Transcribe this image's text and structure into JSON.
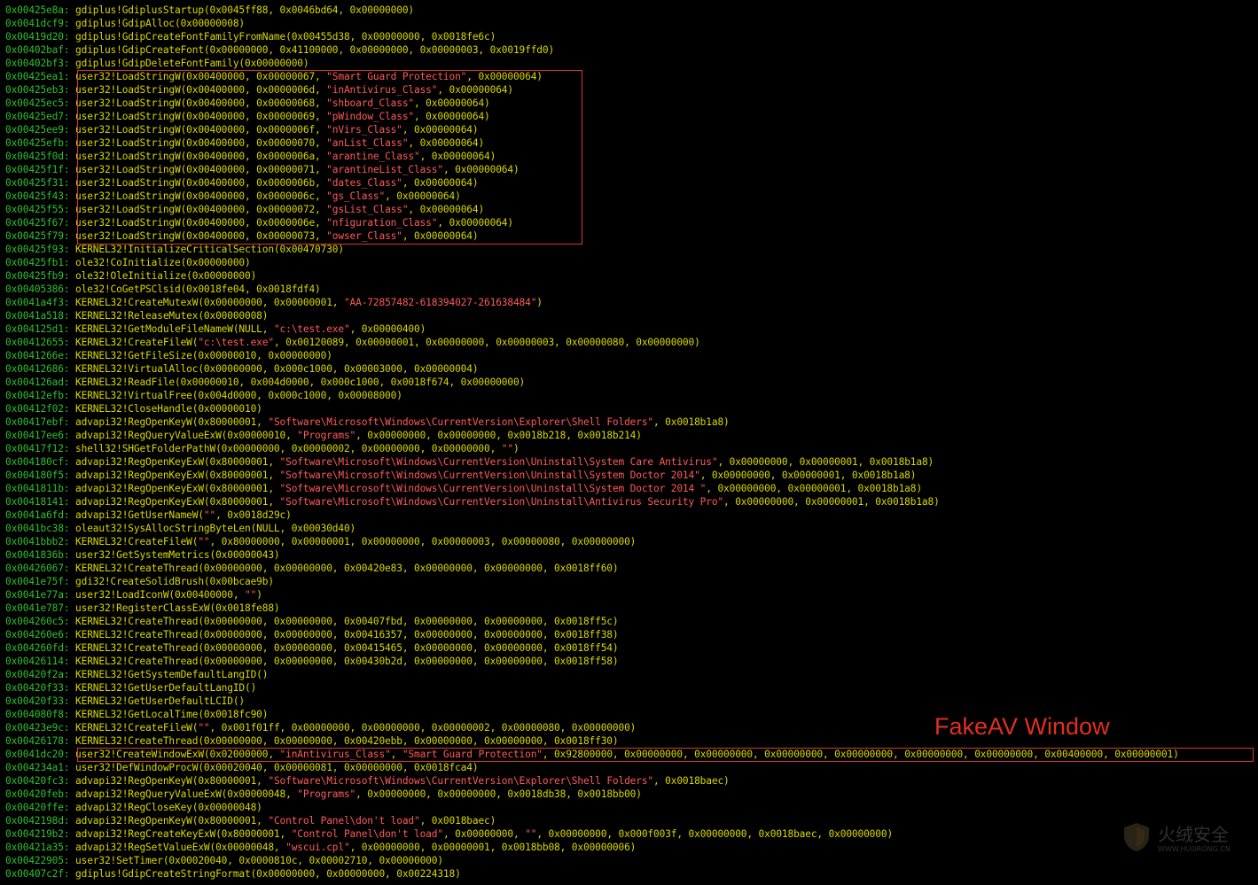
{
  "caption": "FakeAV Window",
  "watermark": {
    "cn": "火绒安全",
    "en": "WWW.HUORONG.CN",
    "icon": "shield-logo-icon"
  },
  "colors": {
    "address": "#2ec02e",
    "function": "#d8d800",
    "string": "#ff5a5a",
    "highlight_box": "#d83a30",
    "caption": "#e0301e"
  },
  "log": [
    {
      "addr": "0x00425e8a:",
      "segs": [
        [
          "f",
          "gdiplus!GdiplusStartup(0x0045ff88, 0x0046bd64, 0x00000000)"
        ]
      ]
    },
    {
      "addr": "0x0041dcf9:",
      "segs": [
        [
          "f",
          "gdiplus!GdipAlloc(0x00000008)"
        ]
      ]
    },
    {
      "addr": "0x00419d20:",
      "segs": [
        [
          "f",
          "gdiplus!GdipCreateFontFamilyFromName(0x00455d38, 0x00000000, 0x0018fe6c)"
        ]
      ]
    },
    {
      "addr": "0x00402baf:",
      "segs": [
        [
          "f",
          "gdiplus!GdipCreateFont(0x00000000, 0x41100000, 0x00000000, 0x00000003, 0x0019ffd0)"
        ]
      ]
    },
    {
      "addr": "0x00402bf3:",
      "segs": [
        [
          "f",
          "gdiplus!GdipDeleteFontFamily(0x00000000)"
        ]
      ]
    },
    {
      "addr": "0x00425ea1:",
      "segs": [
        [
          "f",
          "user32!LoadStringW(0x00400000, 0x00000067, "
        ],
        [
          "s",
          "\"Smart Guard Protection\""
        ],
        [
          "f",
          ", 0x00000064)"
        ]
      ]
    },
    {
      "addr": "0x00425eb3:",
      "segs": [
        [
          "f",
          "user32!LoadStringW(0x00400000, 0x0000006d, "
        ],
        [
          "s",
          "\"inAntivirus_Class\""
        ],
        [
          "f",
          ", 0x00000064)"
        ]
      ]
    },
    {
      "addr": "0x00425ec5:",
      "segs": [
        [
          "f",
          "user32!LoadStringW(0x00400000, 0x00000068, "
        ],
        [
          "s",
          "\"shboard_Class\""
        ],
        [
          "f",
          ", 0x00000064)"
        ]
      ]
    },
    {
      "addr": "0x00425ed7:",
      "segs": [
        [
          "f",
          "user32!LoadStringW(0x00400000, 0x00000069, "
        ],
        [
          "s",
          "\"pWindow_Class\""
        ],
        [
          "f",
          ", 0x00000064)"
        ]
      ]
    },
    {
      "addr": "0x00425ee9:",
      "segs": [
        [
          "f",
          "user32!LoadStringW(0x00400000, 0x0000006f, "
        ],
        [
          "s",
          "\"nVirs_Class\""
        ],
        [
          "f",
          ", 0x00000064)"
        ]
      ]
    },
    {
      "addr": "0x00425efb:",
      "segs": [
        [
          "f",
          "user32!LoadStringW(0x00400000, 0x00000070, "
        ],
        [
          "s",
          "\"anList_Class\""
        ],
        [
          "f",
          ", 0x00000064)"
        ]
      ]
    },
    {
      "addr": "0x00425f0d:",
      "segs": [
        [
          "f",
          "user32!LoadStringW(0x00400000, 0x0000006a, "
        ],
        [
          "s",
          "\"arantine_Class\""
        ],
        [
          "f",
          ", 0x00000064)"
        ]
      ]
    },
    {
      "addr": "0x00425f1f:",
      "segs": [
        [
          "f",
          "user32!LoadStringW(0x00400000, 0x00000071, "
        ],
        [
          "s",
          "\"arantineList_Class\""
        ],
        [
          "f",
          ", 0x00000064)"
        ]
      ]
    },
    {
      "addr": "0x00425f31:",
      "segs": [
        [
          "f",
          "user32!LoadStringW(0x00400000, 0x0000006b, "
        ],
        [
          "s",
          "\"dates_Class\""
        ],
        [
          "f",
          ", 0x00000064)"
        ]
      ]
    },
    {
      "addr": "0x00425f43:",
      "segs": [
        [
          "f",
          "user32!LoadStringW(0x00400000, 0x0000006c, "
        ],
        [
          "s",
          "\"gs_Class\""
        ],
        [
          "f",
          ", 0x00000064)"
        ]
      ]
    },
    {
      "addr": "0x00425f55:",
      "segs": [
        [
          "f",
          "user32!LoadStringW(0x00400000, 0x00000072, "
        ],
        [
          "s",
          "\"gsList_Class\""
        ],
        [
          "f",
          ", 0x00000064)"
        ]
      ]
    },
    {
      "addr": "0x00425f67:",
      "segs": [
        [
          "f",
          "user32!LoadStringW(0x00400000, 0x0000006e, "
        ],
        [
          "s",
          "\"nfiguration_Class\""
        ],
        [
          "f",
          ", 0x00000064)"
        ]
      ]
    },
    {
      "addr": "0x00425f79:",
      "segs": [
        [
          "f",
          "user32!LoadStringW(0x00400000, 0x00000073, "
        ],
        [
          "s",
          "\"owser_Class\""
        ],
        [
          "f",
          ", 0x00000064)"
        ]
      ]
    },
    {
      "addr": "0x00425f93:",
      "segs": [
        [
          "f",
          "KERNEL32!InitializeCriticalSection(0x00470730)"
        ]
      ]
    },
    {
      "addr": "0x00425fb1:",
      "segs": [
        [
          "f",
          "ole32!CoInitialize(0x00000000)"
        ]
      ]
    },
    {
      "addr": "0x00425fb9:",
      "segs": [
        [
          "f",
          "ole32!OleInitialize(0x00000000)"
        ]
      ]
    },
    {
      "addr": "0x00405386:",
      "segs": [
        [
          "f",
          "ole32!CoGetPSClsid(0x0018fe04, 0x0018fdf4)"
        ]
      ]
    },
    {
      "addr": "0x0041a4f3:",
      "segs": [
        [
          "f",
          "KERNEL32!CreateMutexW(0x00000000, 0x00000001, "
        ],
        [
          "s",
          "\"AA-72857482-618394027-261638484\""
        ],
        [
          "f",
          ")"
        ]
      ]
    },
    {
      "addr": "0x0041a518:",
      "segs": [
        [
          "f",
          "KERNEL32!ReleaseMutex(0x00000008)"
        ]
      ]
    },
    {
      "addr": "0x004125d1:",
      "segs": [
        [
          "f",
          "KERNEL32!GetModuleFileNameW(NULL, "
        ],
        [
          "s",
          "\"c:\\test.exe\""
        ],
        [
          "f",
          ", 0x00000400)"
        ]
      ]
    },
    {
      "addr": "0x00412655:",
      "segs": [
        [
          "f",
          "KERNEL32!CreateFileW("
        ],
        [
          "s",
          "\"c:\\test.exe\""
        ],
        [
          "f",
          ", 0x00120089, 0x00000001, 0x00000000, 0x00000003, 0x00000080, 0x00000000)"
        ]
      ]
    },
    {
      "addr": "0x0041266e:",
      "segs": [
        [
          "f",
          "KERNEL32!GetFileSize(0x00000010, 0x00000000)"
        ]
      ]
    },
    {
      "addr": "0x00412686:",
      "segs": [
        [
          "f",
          "KERNEL32!VirtualAlloc(0x00000000, 0x000c1000, 0x00003000, 0x00000004)"
        ]
      ]
    },
    {
      "addr": "0x004126ad:",
      "segs": [
        [
          "f",
          "KERNEL32!ReadFile(0x00000010, 0x004d0000, 0x000c1000, 0x0018f674, 0x00000000)"
        ]
      ]
    },
    {
      "addr": "0x00412efb:",
      "segs": [
        [
          "f",
          "KERNEL32!VirtualFree(0x004d0000, 0x000c1000, 0x00008000)"
        ]
      ]
    },
    {
      "addr": "0x00412f02:",
      "segs": [
        [
          "f",
          "KERNEL32!CloseHandle(0x00000010)"
        ]
      ]
    },
    {
      "addr": "0x00417ebf:",
      "segs": [
        [
          "f",
          "advapi32!RegOpenKeyW(0x80000001, "
        ],
        [
          "s",
          "\"Software\\Microsoft\\Windows\\CurrentVersion\\Explorer\\Shell Folders\""
        ],
        [
          "f",
          ", 0x0018b1a8)"
        ]
      ]
    },
    {
      "addr": "0x00417ee6:",
      "segs": [
        [
          "f",
          "advapi32!RegQueryValueExW(0x00000010, "
        ],
        [
          "s",
          "\"Programs\""
        ],
        [
          "f",
          ", 0x00000000, 0x00000000, 0x0018b218, 0x0018b214)"
        ]
      ]
    },
    {
      "addr": "0x00417f12:",
      "segs": [
        [
          "f",
          "shell32!SHGetFolderPathW(0x00000000, 0x00000002, 0x00000000, 0x00000000, "
        ],
        [
          "s",
          "\"\""
        ],
        [
          "f",
          ")"
        ]
      ]
    },
    {
      "addr": "0x004180cf:",
      "segs": [
        [
          "f",
          "advapi32!RegOpenKeyExW(0x80000001, "
        ],
        [
          "s",
          "\"Software\\Microsoft\\Windows\\CurrentVersion\\Uninstall\\System Care Antivirus\""
        ],
        [
          "f",
          ", 0x00000000, 0x00000001, 0x0018b1a8)"
        ]
      ]
    },
    {
      "addr": "0x004180f5:",
      "segs": [
        [
          "f",
          "advapi32!RegOpenKeyExW(0x80000001, "
        ],
        [
          "s",
          "\"Software\\Microsoft\\Windows\\CurrentVersion\\Uninstall\\System Doctor 2014\""
        ],
        [
          "f",
          ", 0x00000000, 0x00000001, 0x0018b1a8)"
        ]
      ]
    },
    {
      "addr": "0x0041811b:",
      "segs": [
        [
          "f",
          "advapi32!RegOpenKeyExW(0x80000001, "
        ],
        [
          "s",
          "\"Software\\Microsoft\\Windows\\CurrentVersion\\Uninstall\\System Doctor 2014 \""
        ],
        [
          "f",
          ", 0x00000000, 0x00000001, 0x0018b1a8)"
        ]
      ]
    },
    {
      "addr": "0x00418141:",
      "segs": [
        [
          "f",
          "advapi32!RegOpenKeyExW(0x80000001, "
        ],
        [
          "s",
          "\"Software\\Microsoft\\Windows\\CurrentVersion\\Uninstall\\Antivirus Security Pro\""
        ],
        [
          "f",
          ", 0x00000000, 0x00000001, 0x0018b1a8)"
        ]
      ]
    },
    {
      "addr": "0x0041a6fd:",
      "segs": [
        [
          "f",
          "advapi32!GetUserNameW("
        ],
        [
          "s",
          "\"\""
        ],
        [
          "f",
          ", 0x0018d29c)"
        ]
      ]
    },
    {
      "addr": "0x0041bc38:",
      "segs": [
        [
          "f",
          "oleaut32!SysAllocStringByteLen(NULL, 0x00030d40)"
        ]
      ]
    },
    {
      "addr": "0x0041bbb2:",
      "segs": [
        [
          "f",
          "KERNEL32!CreateFileW("
        ],
        [
          "s",
          "\"\""
        ],
        [
          "f",
          ", 0x80000000, 0x00000001, 0x00000000, 0x00000003, 0x00000080, 0x00000000)"
        ]
      ]
    },
    {
      "addr": "0x0041836b:",
      "segs": [
        [
          "f",
          "user32!GetSystemMetrics(0x00000043)"
        ]
      ]
    },
    {
      "addr": "0x00426067:",
      "segs": [
        [
          "f",
          "KERNEL32!CreateThread(0x00000000, 0x00000000, 0x00420e83, 0x00000000, 0x00000000, 0x0018ff60)"
        ]
      ]
    },
    {
      "addr": "0x0041e75f:",
      "segs": [
        [
          "f",
          "gdi32!CreateSolidBrush(0x00bcae9b)"
        ]
      ]
    },
    {
      "addr": "0x0041e77a:",
      "segs": [
        [
          "f",
          "user32!LoadIconW(0x00400000, "
        ],
        [
          "s",
          "\"\""
        ],
        [
          "f",
          ")"
        ]
      ]
    },
    {
      "addr": "0x0041e787:",
      "segs": [
        [
          "f",
          "user32!RegisterClassExW(0x0018fe88)"
        ]
      ]
    },
    {
      "addr": "0x004260c5:",
      "segs": [
        [
          "f",
          "KERNEL32!CreateThread(0x00000000, 0x00000000, 0x00407fbd, 0x00000000, 0x00000000, 0x0018ff5c)"
        ]
      ]
    },
    {
      "addr": "0x004260e6:",
      "segs": [
        [
          "f",
          "KERNEL32!CreateThread(0x00000000, 0x00000000, 0x00416357, 0x00000000, 0x00000000, 0x0018ff38)"
        ]
      ]
    },
    {
      "addr": "0x004260fd:",
      "segs": [
        [
          "f",
          "KERNEL32!CreateThread(0x00000000, 0x00000000, 0x00415465, 0x00000000, 0x00000000, 0x0018ff54)"
        ]
      ]
    },
    {
      "addr": "0x00426114:",
      "segs": [
        [
          "f",
          "KERNEL32!CreateThread(0x00000000, 0x00000000, 0x00430b2d, 0x00000000, 0x00000000, 0x0018ff58)"
        ]
      ]
    },
    {
      "addr": "0x00420f2a:",
      "segs": [
        [
          "f",
          "KERNEL32!GetSystemDefaultLangID()"
        ]
      ]
    },
    {
      "addr": "0x00420f33:",
      "segs": [
        [
          "f",
          "KERNEL32!GetUserDefaultLangID()"
        ]
      ]
    },
    {
      "addr": "0x00420f33:",
      "segs": [
        [
          "f",
          "KERNEL32!GetUserDefaultLCID()"
        ]
      ]
    },
    {
      "addr": "0x004080f8:",
      "segs": [
        [
          "f",
          "KERNEL32!GetLocalTime(0x0018fc90)"
        ]
      ]
    },
    {
      "addr": "0x00423e9c:",
      "segs": [
        [
          "f",
          "KERNEL32!CreateFileW("
        ],
        [
          "s",
          "\"\""
        ],
        [
          "f",
          ", 0x001f01ff, 0x00000000, 0x00000000, 0x00000002, 0x00000080, 0x00000000)"
        ]
      ]
    },
    {
      "addr": "0x00426178:",
      "segs": [
        [
          "f",
          "KERNEL32!CreateThread(0x00000000, 0x00000000, 0x00420ebb, 0x00000000, 0x00000000, 0x0018ff30)"
        ]
      ]
    },
    {
      "addr": "0x0041dc20:",
      "segs": [
        [
          "f",
          "user32!CreateWindowExW(0x02000000, "
        ],
        [
          "s",
          "\"inAntivirus_Class\""
        ],
        [
          "f",
          ", "
        ],
        [
          "s",
          "\"Smart Guard Protection\""
        ],
        [
          "f",
          ", 0x92800000, 0x00000000, 0x00000000, 0x00000000, 0x00000000, 0x00000000, 0x00000000, 0x00400000, 0x00000001)"
        ]
      ]
    },
    {
      "addr": "0x004234a1:",
      "segs": [
        [
          "f",
          "user32!DefWindowProcW(0x00020040, 0x00000081, 0x00000000, 0x0018fca4)"
        ]
      ]
    },
    {
      "addr": "0x00420fc3:",
      "segs": [
        [
          "f",
          "advapi32!RegOpenKeyW(0x80000001, "
        ],
        [
          "s",
          "\"Software\\Microsoft\\Windows\\CurrentVersion\\Explorer\\Shell Folders\""
        ],
        [
          "f",
          ", 0x0018baec)"
        ]
      ]
    },
    {
      "addr": "0x00420feb:",
      "segs": [
        [
          "f",
          "advapi32!RegQueryValueExW(0x00000048, "
        ],
        [
          "s",
          "\"Programs\""
        ],
        [
          "f",
          ", 0x00000000, 0x00000000, 0x0018db38, 0x0018bb00)"
        ]
      ]
    },
    {
      "addr": "0x00420ffe:",
      "segs": [
        [
          "f",
          "advapi32!RegCloseKey(0x00000048)"
        ]
      ]
    },
    {
      "addr": "0x0042198d:",
      "segs": [
        [
          "f",
          "advapi32!RegOpenKeyW(0x80000001, "
        ],
        [
          "s",
          "\"Control Panel\\don't load\""
        ],
        [
          "f",
          ", 0x0018baec)"
        ]
      ]
    },
    {
      "addr": "0x004219b2:",
      "segs": [
        [
          "f",
          "advapi32!RegCreateKeyExW(0x80000001, "
        ],
        [
          "s",
          "\"Control Panel\\don't load\""
        ],
        [
          "f",
          ", 0x00000000, "
        ],
        [
          "s",
          "\"\""
        ],
        [
          "f",
          ", 0x00000000, 0x000f003f, 0x00000000, 0x0018baec, 0x00000000)"
        ]
      ]
    },
    {
      "addr": "0x00421a35:",
      "segs": [
        [
          "f",
          "advapi32!RegSetValueExW(0x00000048, "
        ],
        [
          "s",
          "\"wscui.cpl\""
        ],
        [
          "f",
          ", 0x00000000, 0x00000001, 0x0018bb08, 0x00000006)"
        ]
      ]
    },
    {
      "addr": "0x00422905:",
      "segs": [
        [
          "f",
          "user32!SetTimer(0x00020040, 0x0000810c, 0x00002710, 0x00000000)"
        ]
      ]
    },
    {
      "addr": "0x00407c2f:",
      "segs": [
        [
          "f",
          "gdiplus!GdipCreateStringFormat(0x00000000, 0x00000000, 0x00224318)"
        ]
      ]
    }
  ]
}
